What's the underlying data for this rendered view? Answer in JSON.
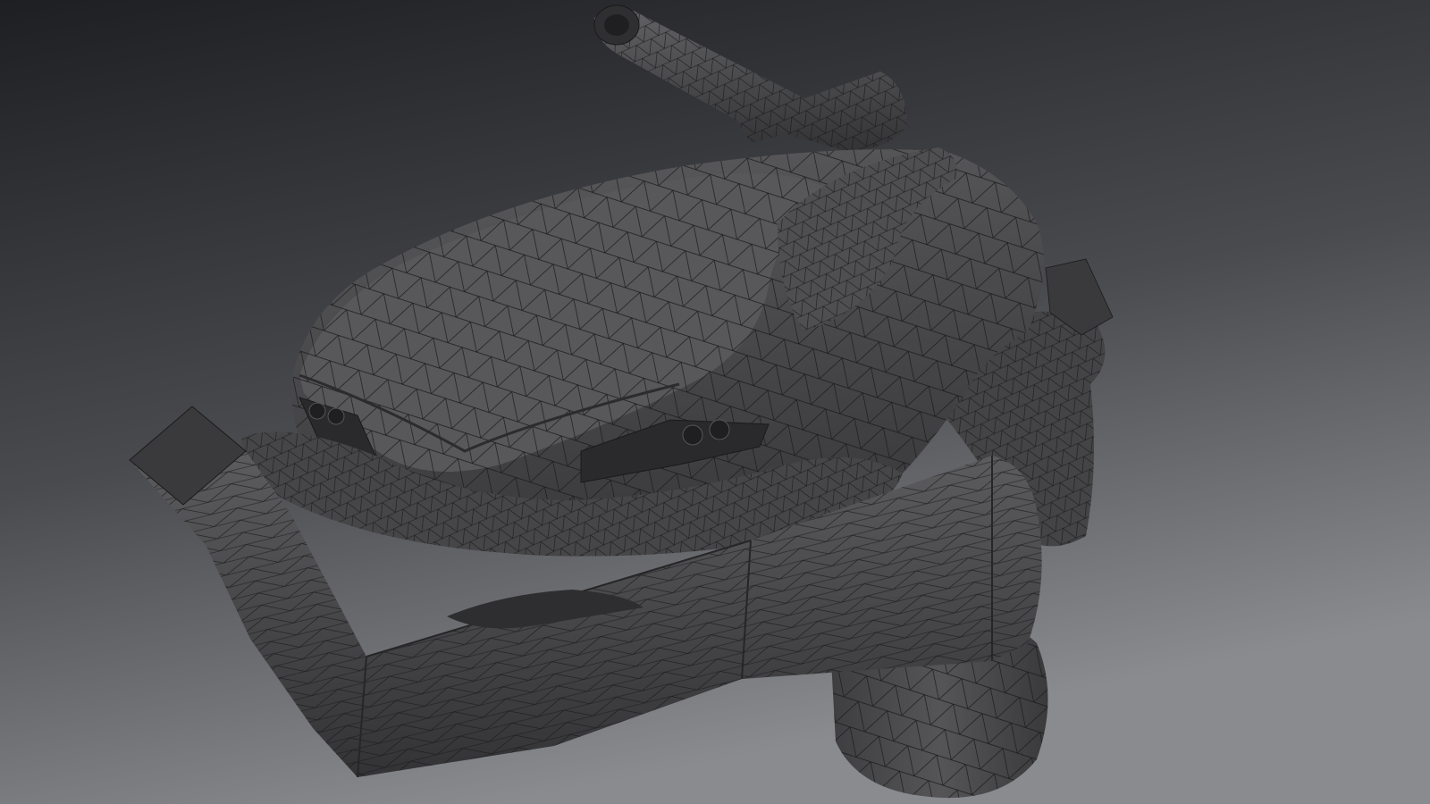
{
  "viewport": {
    "shading": "wireframe-on-shaded",
    "subject": "vehicle-model",
    "colors": {
      "background_top": "#1e1f22",
      "background_bottom": "#88898d",
      "model_base": "#4c4c4e",
      "wire": "#1a1a1b"
    }
  }
}
